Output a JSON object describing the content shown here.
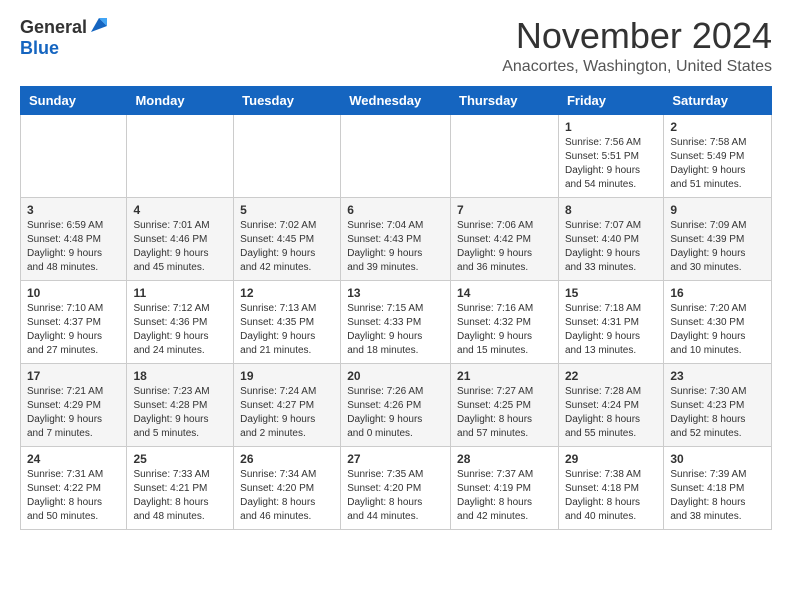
{
  "header": {
    "logo_general": "General",
    "logo_blue": "Blue",
    "month_title": "November 2024",
    "location": "Anacortes, Washington, United States"
  },
  "calendar": {
    "days_of_week": [
      "Sunday",
      "Monday",
      "Tuesday",
      "Wednesday",
      "Thursday",
      "Friday",
      "Saturday"
    ],
    "weeks": [
      [
        {
          "day": "",
          "info": ""
        },
        {
          "day": "",
          "info": ""
        },
        {
          "day": "",
          "info": ""
        },
        {
          "day": "",
          "info": ""
        },
        {
          "day": "",
          "info": ""
        },
        {
          "day": "1",
          "info": "Sunrise: 7:56 AM\nSunset: 5:51 PM\nDaylight: 9 hours\nand 54 minutes."
        },
        {
          "day": "2",
          "info": "Sunrise: 7:58 AM\nSunset: 5:49 PM\nDaylight: 9 hours\nand 51 minutes."
        }
      ],
      [
        {
          "day": "3",
          "info": "Sunrise: 6:59 AM\nSunset: 4:48 PM\nDaylight: 9 hours\nand 48 minutes."
        },
        {
          "day": "4",
          "info": "Sunrise: 7:01 AM\nSunset: 4:46 PM\nDaylight: 9 hours\nand 45 minutes."
        },
        {
          "day": "5",
          "info": "Sunrise: 7:02 AM\nSunset: 4:45 PM\nDaylight: 9 hours\nand 42 minutes."
        },
        {
          "day": "6",
          "info": "Sunrise: 7:04 AM\nSunset: 4:43 PM\nDaylight: 9 hours\nand 39 minutes."
        },
        {
          "day": "7",
          "info": "Sunrise: 7:06 AM\nSunset: 4:42 PM\nDaylight: 9 hours\nand 36 minutes."
        },
        {
          "day": "8",
          "info": "Sunrise: 7:07 AM\nSunset: 4:40 PM\nDaylight: 9 hours\nand 33 minutes."
        },
        {
          "day": "9",
          "info": "Sunrise: 7:09 AM\nSunset: 4:39 PM\nDaylight: 9 hours\nand 30 minutes."
        }
      ],
      [
        {
          "day": "10",
          "info": "Sunrise: 7:10 AM\nSunset: 4:37 PM\nDaylight: 9 hours\nand 27 minutes."
        },
        {
          "day": "11",
          "info": "Sunrise: 7:12 AM\nSunset: 4:36 PM\nDaylight: 9 hours\nand 24 minutes."
        },
        {
          "day": "12",
          "info": "Sunrise: 7:13 AM\nSunset: 4:35 PM\nDaylight: 9 hours\nand 21 minutes."
        },
        {
          "day": "13",
          "info": "Sunrise: 7:15 AM\nSunset: 4:33 PM\nDaylight: 9 hours\nand 18 minutes."
        },
        {
          "day": "14",
          "info": "Sunrise: 7:16 AM\nSunset: 4:32 PM\nDaylight: 9 hours\nand 15 minutes."
        },
        {
          "day": "15",
          "info": "Sunrise: 7:18 AM\nSunset: 4:31 PM\nDaylight: 9 hours\nand 13 minutes."
        },
        {
          "day": "16",
          "info": "Sunrise: 7:20 AM\nSunset: 4:30 PM\nDaylight: 9 hours\nand 10 minutes."
        }
      ],
      [
        {
          "day": "17",
          "info": "Sunrise: 7:21 AM\nSunset: 4:29 PM\nDaylight: 9 hours\nand 7 minutes."
        },
        {
          "day": "18",
          "info": "Sunrise: 7:23 AM\nSunset: 4:28 PM\nDaylight: 9 hours\nand 5 minutes."
        },
        {
          "day": "19",
          "info": "Sunrise: 7:24 AM\nSunset: 4:27 PM\nDaylight: 9 hours\nand 2 minutes."
        },
        {
          "day": "20",
          "info": "Sunrise: 7:26 AM\nSunset: 4:26 PM\nDaylight: 9 hours\nand 0 minutes."
        },
        {
          "day": "21",
          "info": "Sunrise: 7:27 AM\nSunset: 4:25 PM\nDaylight: 8 hours\nand 57 minutes."
        },
        {
          "day": "22",
          "info": "Sunrise: 7:28 AM\nSunset: 4:24 PM\nDaylight: 8 hours\nand 55 minutes."
        },
        {
          "day": "23",
          "info": "Sunrise: 7:30 AM\nSunset: 4:23 PM\nDaylight: 8 hours\nand 52 minutes."
        }
      ],
      [
        {
          "day": "24",
          "info": "Sunrise: 7:31 AM\nSunset: 4:22 PM\nDaylight: 8 hours\nand 50 minutes."
        },
        {
          "day": "25",
          "info": "Sunrise: 7:33 AM\nSunset: 4:21 PM\nDaylight: 8 hours\nand 48 minutes."
        },
        {
          "day": "26",
          "info": "Sunrise: 7:34 AM\nSunset: 4:20 PM\nDaylight: 8 hours\nand 46 minutes."
        },
        {
          "day": "27",
          "info": "Sunrise: 7:35 AM\nSunset: 4:20 PM\nDaylight: 8 hours\nand 44 minutes."
        },
        {
          "day": "28",
          "info": "Sunrise: 7:37 AM\nSunset: 4:19 PM\nDaylight: 8 hours\nand 42 minutes."
        },
        {
          "day": "29",
          "info": "Sunrise: 7:38 AM\nSunset: 4:18 PM\nDaylight: 8 hours\nand 40 minutes."
        },
        {
          "day": "30",
          "info": "Sunrise: 7:39 AM\nSunset: 4:18 PM\nDaylight: 8 hours\nand 38 minutes."
        }
      ]
    ]
  }
}
